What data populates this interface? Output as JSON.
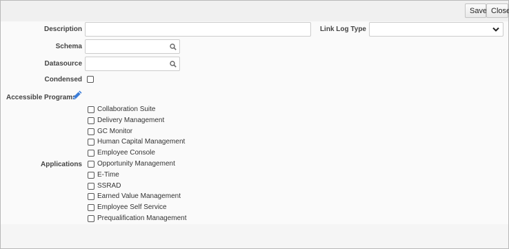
{
  "toolbar": {
    "save_label": "Save",
    "close_label": "Close"
  },
  "form": {
    "description_label": "Description",
    "description_value": "",
    "link_log_type_label": "Link Log Type",
    "link_log_type_value": "",
    "schema_label": "Schema",
    "schema_value": "",
    "datasource_label": "Datasource",
    "datasource_value": "",
    "condensed_label": "Condensed",
    "accessible_programs_label": "Accessible Programs",
    "applications_label": "Applications"
  },
  "applications": [
    "Collaboration Suite",
    "Delivery Management",
    "GC Monitor",
    "Human Capital Management",
    "Employee Console",
    "Opportunity Management",
    "E-Time",
    "SSRAD",
    "Earned Value Management",
    "Employee Self Service",
    "Prequalification Management"
  ],
  "icons": {
    "search": "search-icon",
    "dropdown": "chevron-down-icon",
    "edit": "pencil-icon"
  },
  "colors": {
    "pencil_icon": "#3b7dd8"
  }
}
